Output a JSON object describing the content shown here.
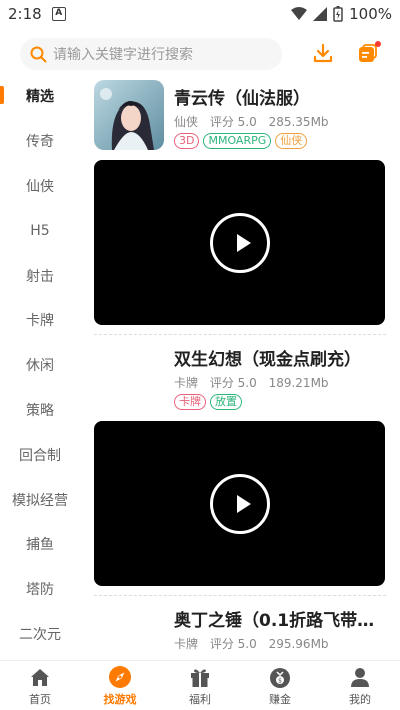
{
  "status": {
    "time": "2:18",
    "notif_glyph": "A",
    "battery": "100%"
  },
  "search": {
    "placeholder": "请输入关键字进行搜索"
  },
  "sidebar": {
    "items": [
      {
        "label": "精选",
        "active": true
      },
      {
        "label": "传奇"
      },
      {
        "label": "仙侠"
      },
      {
        "label": "H5"
      },
      {
        "label": "射击"
      },
      {
        "label": "卡牌"
      },
      {
        "label": "休闲"
      },
      {
        "label": "策略"
      },
      {
        "label": "回合制"
      },
      {
        "label": "模拟经营"
      },
      {
        "label": "捕鱼"
      },
      {
        "label": "塔防"
      },
      {
        "label": "二次元"
      }
    ]
  },
  "games": [
    {
      "title": "青云传（仙法服）",
      "category": "仙侠",
      "rating": "评分 5.0",
      "size": "285.35Mb",
      "tags": [
        {
          "label": "3D",
          "color": "#e8627a"
        },
        {
          "label": "MMOARPG",
          "color": "#2db67c"
        },
        {
          "label": "仙侠",
          "color": "#f0a040"
        }
      ]
    },
    {
      "title": "双生幻想（现金点刷充）",
      "category": "卡牌",
      "rating": "评分 5.0",
      "size": "189.21Mb",
      "tags": [
        {
          "label": "卡牌",
          "color": "#e8627a"
        },
        {
          "label": "放置",
          "color": "#2db67c"
        }
      ]
    },
    {
      "title": "奥丁之锤（0.1折路飞带…",
      "category": "卡牌",
      "rating": "评分 5.0",
      "size": "295.96Mb",
      "tags": []
    }
  ],
  "bottom_nav": [
    {
      "label": "首页"
    },
    {
      "label": "找游戏",
      "active": true
    },
    {
      "label": "福利"
    },
    {
      "label": "赚金"
    },
    {
      "label": "我的"
    }
  ],
  "colors": {
    "accent": "#ff7a00"
  }
}
